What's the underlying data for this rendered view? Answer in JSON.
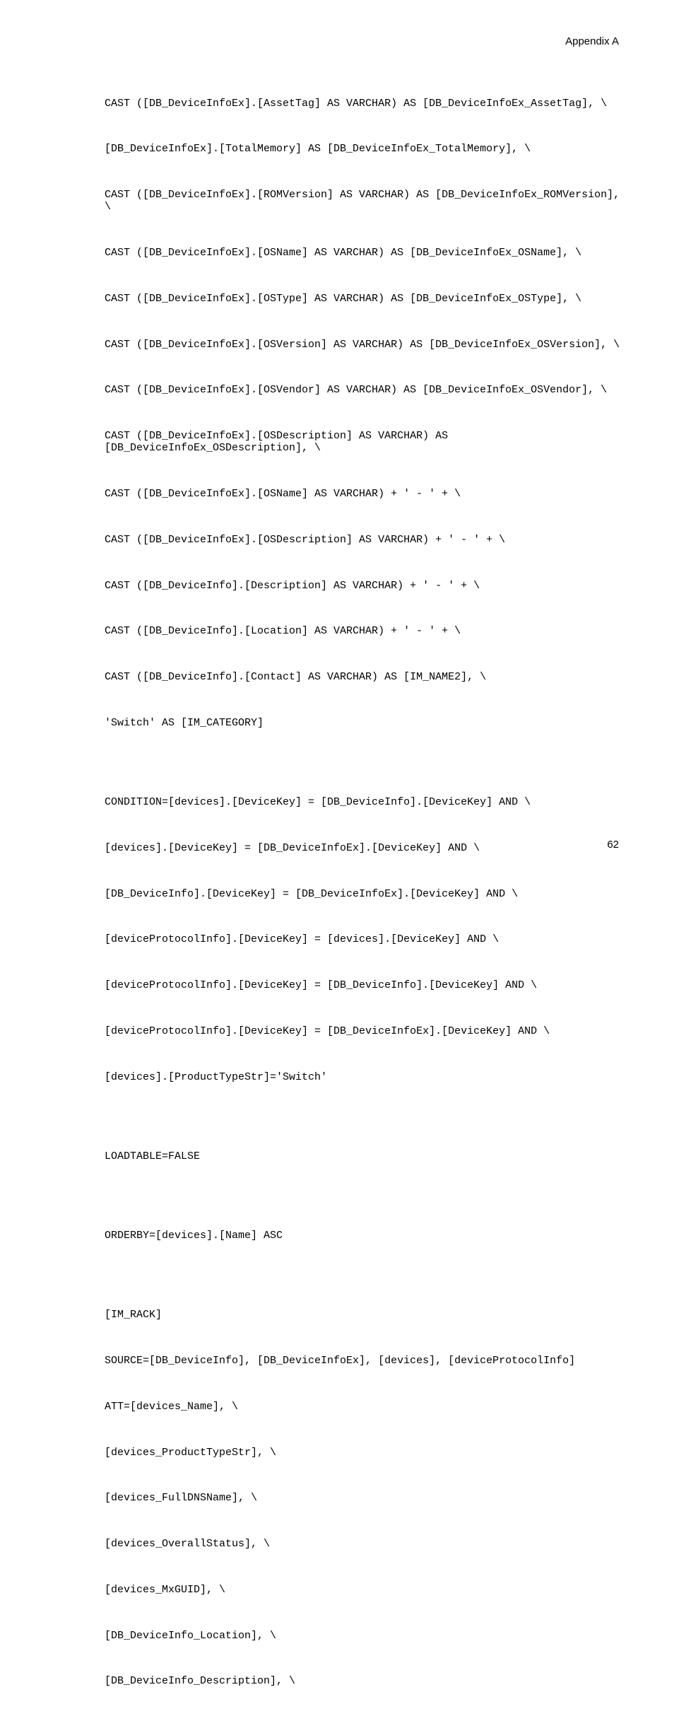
{
  "header": {
    "label": "Appendix A"
  },
  "page_number": "62",
  "code": {
    "lines": [
      "CAST ([DB_DeviceInfoEx].[AssetTag] AS VARCHAR) AS [DB_DeviceInfoEx_AssetTag], \\",
      "[DB_DeviceInfoEx].[TotalMemory] AS [DB_DeviceInfoEx_TotalMemory], \\",
      "CAST ([DB_DeviceInfoEx].[ROMVersion] AS VARCHAR) AS [DB_DeviceInfoEx_ROMVersion], \\",
      "CAST ([DB_DeviceInfoEx].[OSName] AS VARCHAR) AS [DB_DeviceInfoEx_OSName], \\",
      "CAST ([DB_DeviceInfoEx].[OSType] AS VARCHAR) AS [DB_DeviceInfoEx_OSType], \\",
      "CAST ([DB_DeviceInfoEx].[OSVersion] AS VARCHAR) AS [DB_DeviceInfoEx_OSVersion], \\",
      "CAST ([DB_DeviceInfoEx].[OSVendor] AS VARCHAR) AS [DB_DeviceInfoEx_OSVendor], \\",
      "CAST ([DB_DeviceInfoEx].[OSDescription] AS VARCHAR) AS [DB_DeviceInfoEx_OSDescription], \\",
      "CAST ([DB_DeviceInfoEx].[OSName] AS VARCHAR) + ' - ' + \\",
      "CAST ([DB_DeviceInfoEx].[OSDescription] AS VARCHAR) + ' - ' + \\",
      "CAST ([DB_DeviceInfo].[Description] AS VARCHAR) + ' - ' + \\",
      "CAST ([DB_DeviceInfo].[Location] AS VARCHAR) + ' - ' + \\",
      "CAST ([DB_DeviceInfo].[Contact] AS VARCHAR) AS [IM_NAME2], \\",
      "'Switch' AS [IM_CATEGORY]",
      "",
      "CONDITION=[devices].[DeviceKey] = [DB_DeviceInfo].[DeviceKey] AND \\",
      "[devices].[DeviceKey] = [DB_DeviceInfoEx].[DeviceKey] AND \\",
      "[DB_DeviceInfo].[DeviceKey] = [DB_DeviceInfoEx].[DeviceKey] AND \\",
      "[deviceProtocolInfo].[DeviceKey] = [devices].[DeviceKey] AND \\",
      "[deviceProtocolInfo].[DeviceKey] = [DB_DeviceInfo].[DeviceKey] AND \\",
      "[deviceProtocolInfo].[DeviceKey] = [DB_DeviceInfoEx].[DeviceKey] AND \\",
      "[devices].[ProductTypeStr]='Switch'",
      "",
      "LOADTABLE=FALSE",
      "",
      "ORDERBY=[devices].[Name] ASC",
      "",
      "[IM_RACK]",
      "SOURCE=[DB_DeviceInfo], [DB_DeviceInfoEx], [devices], [deviceProtocolInfo]",
      "ATT=[devices_Name], \\",
      "[devices_ProductTypeStr], \\",
      "[devices_FullDNSName], \\",
      "[devices_OverallStatus], \\",
      "[devices_MxGUID], \\",
      "[DB_DeviceInfo_Location], \\",
      "[DB_DeviceInfo_Description], \\"
    ]
  }
}
